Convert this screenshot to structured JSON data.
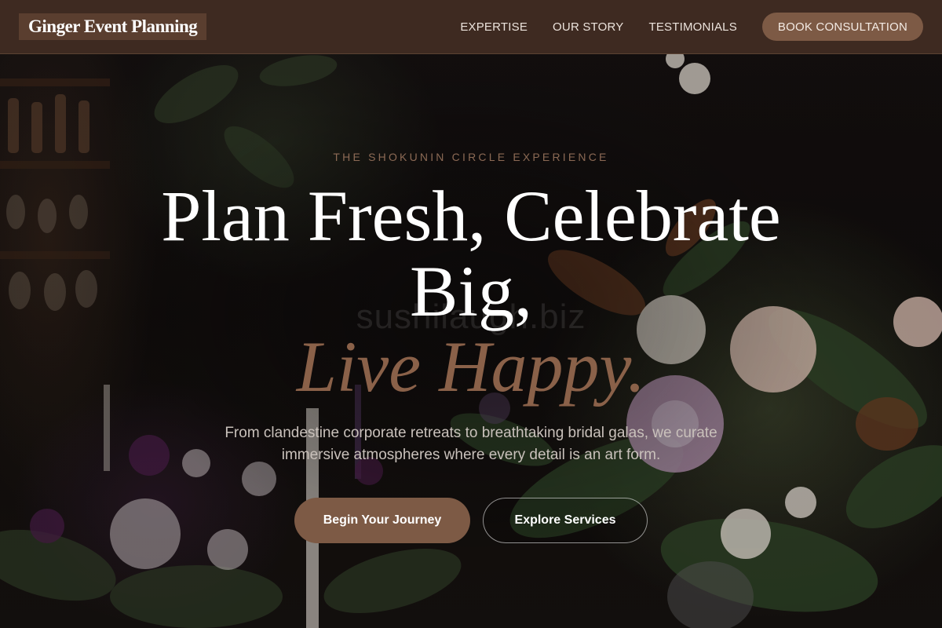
{
  "header": {
    "logo_text": "Ginger Event Planning",
    "nav": [
      {
        "label": "EXPERTISE"
      },
      {
        "label": "OUR STORY"
      },
      {
        "label": "TESTIMONIALS"
      }
    ],
    "cta_label": "BOOK CONSULTATION"
  },
  "hero": {
    "eyebrow": "THE SHOKUNIN CIRCLE EXPERIENCE",
    "headline_line1": "Plan Fresh, Celebrate",
    "headline_line2": "Big,",
    "headline_accent": "Live Happy.",
    "watermark": "sushilaugh.biz",
    "subtext": "From clandestine corporate retreats to breathtaking bridal galas, we curate immersive atmospheres where every detail is an art form.",
    "primary_button": "Begin Your Journey",
    "secondary_button": "Explore Services"
  },
  "colors": {
    "header_bg": "#3e2a21",
    "accent": "#7d5a45",
    "accent_text": "#8a6149",
    "eyebrow": "#8c6a55"
  }
}
